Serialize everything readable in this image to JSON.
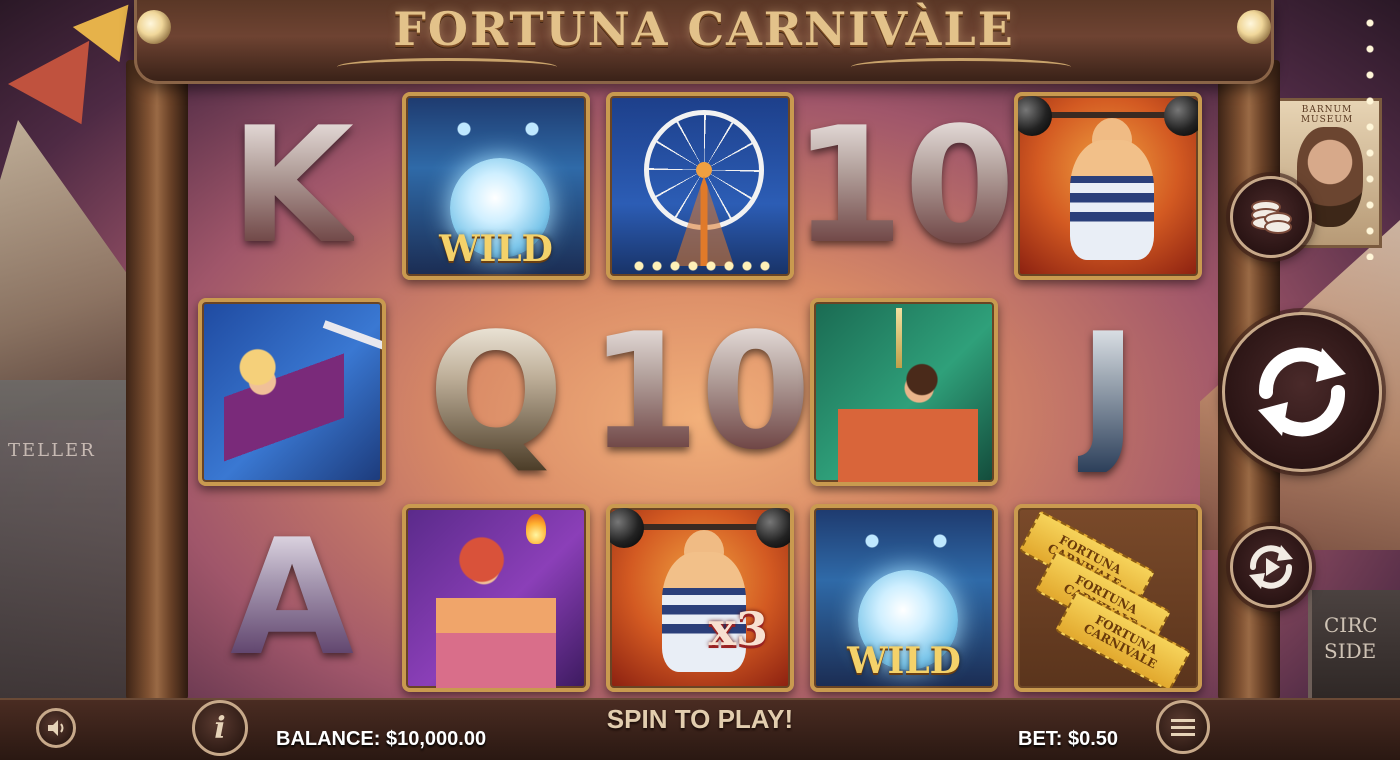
{
  "game": {
    "title": "FORTUNA CARNIVÀLE"
  },
  "scene": {
    "wagon_sign": "TELLER",
    "poster_title": "BARNUM MUSEUM",
    "right_sign": "CIRC SIDE"
  },
  "reels": [
    [
      {
        "type": "letter",
        "text": "K",
        "color": "red"
      },
      {
        "type": "picture",
        "name": "aerialist"
      },
      {
        "type": "letter",
        "text": "A",
        "color": "purple"
      }
    ],
    [
      {
        "type": "picture",
        "name": "fortune-teller",
        "label": "WILD"
      },
      {
        "type": "letter",
        "text": "Q",
        "color": "gold"
      },
      {
        "type": "picture",
        "name": "fire-performer"
      }
    ],
    [
      {
        "type": "picture",
        "name": "ferris-wheel"
      },
      {
        "type": "letter",
        "text": "10",
        "color": "red"
      },
      {
        "type": "picture",
        "name": "strongman",
        "label": "x3"
      }
    ],
    [
      {
        "type": "letter",
        "text": "10",
        "color": "red"
      },
      {
        "type": "picture",
        "name": "sword-swallower"
      },
      {
        "type": "picture",
        "name": "fortune-teller",
        "label": "WILD"
      }
    ],
    [
      {
        "type": "picture",
        "name": "strongman"
      },
      {
        "type": "letter",
        "text": "J",
        "color": "blue"
      },
      {
        "type": "picture",
        "name": "tickets",
        "label": "FORTUNA CARNIVALE"
      }
    ]
  ],
  "controls": {
    "coins_icon": "coins-stack-icon",
    "spin_icon": "refresh-arrows-icon",
    "autoplay_icon": "autoplay-icon"
  },
  "bottom": {
    "spin_prompt": "SPIN TO PLAY!",
    "balance": "BALANCE: $10,000.00",
    "bet": "BET: $0.50",
    "info_label": "i"
  },
  "colors": {
    "frame_wood": "#7e5031",
    "title_gold": "#e3c28a",
    "control_border": "#c7a98a"
  }
}
